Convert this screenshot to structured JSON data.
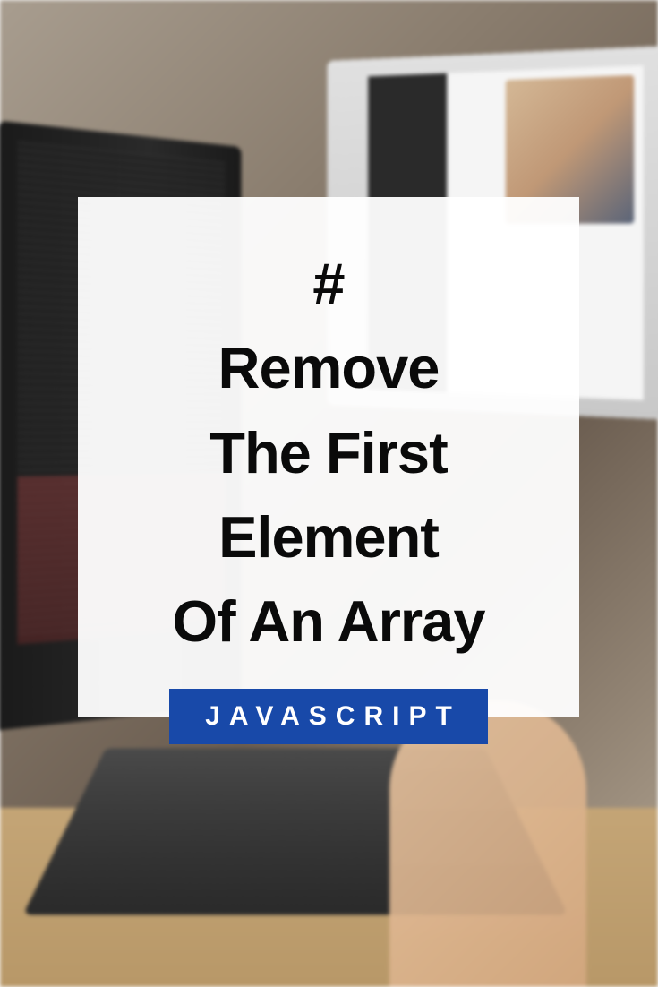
{
  "card": {
    "title": "#\nRemove\nThe First\nElement\nOf An Array",
    "badge": "JAVASCRIPT"
  },
  "colors": {
    "badge_bg": "#1849a9",
    "badge_text": "#ffffff",
    "title_text": "#0a0a0a",
    "card_bg": "rgba(255,255,255,0.95)"
  }
}
